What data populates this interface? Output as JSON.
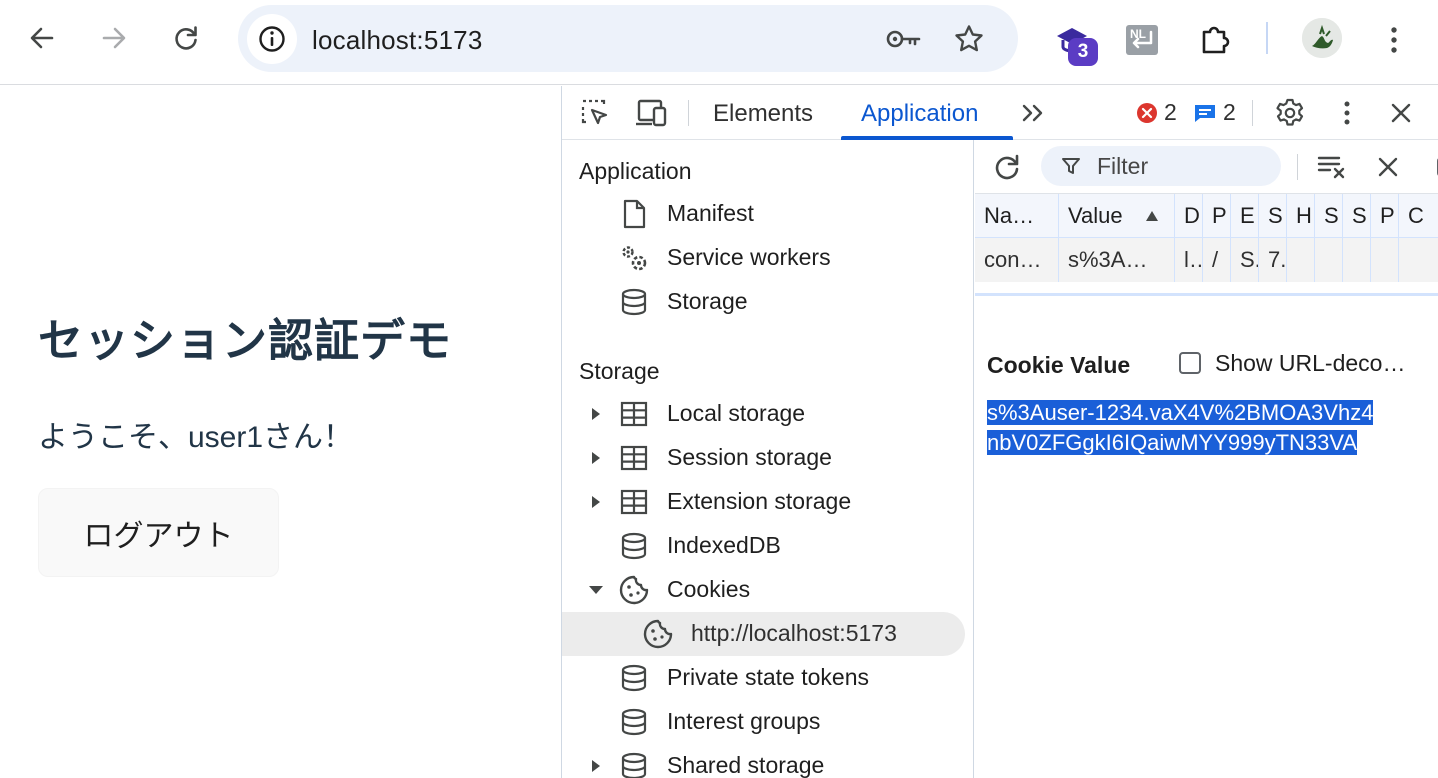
{
  "browser": {
    "url": "localhost:5173",
    "extension_badge": "3"
  },
  "page": {
    "title": "セッション認証デモ",
    "welcome": "ようこそ、user1さん！",
    "logout_label": "ログアウト"
  },
  "devtools": {
    "tabs": [
      {
        "label": "Elements",
        "active": false
      },
      {
        "label": "Application",
        "active": true
      }
    ],
    "error_count": "2",
    "message_count": "2",
    "sidebar": {
      "section_application": "Application",
      "application_items": [
        {
          "label": "Manifest",
          "icon": "document-icon"
        },
        {
          "label": "Service workers",
          "icon": "gears-icon"
        },
        {
          "label": "Storage",
          "icon": "database-icon"
        }
      ],
      "section_storage": "Storage",
      "storage_items": [
        {
          "label": "Local storage",
          "icon": "table-icon",
          "expandable": true
        },
        {
          "label": "Session storage",
          "icon": "table-icon",
          "expandable": true
        },
        {
          "label": "Extension storage",
          "icon": "table-icon",
          "expandable": true
        },
        {
          "label": "IndexedDB",
          "icon": "database-icon",
          "expandable": false
        },
        {
          "label": "Cookies",
          "icon": "cookie-icon",
          "expanded": true
        },
        {
          "label": "http://localhost:5173",
          "icon": "cookie-icon",
          "selected": true
        },
        {
          "label": "Private state tokens",
          "icon": "database-icon",
          "expandable": false
        },
        {
          "label": "Interest groups",
          "icon": "database-icon",
          "expandable": false
        },
        {
          "label": "Shared storage",
          "icon": "database-icon",
          "expandable": true
        }
      ]
    },
    "cookies": {
      "filter_placeholder": "Filter",
      "columns": [
        "Na…",
        "Value",
        "D",
        "P",
        "E",
        "S",
        "H",
        "S",
        "S",
        "P",
        "C"
      ],
      "row": [
        "con…",
        "s%3A…",
        "l…",
        "/",
        "S.",
        "7.",
        "",
        "",
        "",
        "",
        ""
      ],
      "detail_title": "Cookie Value",
      "show_decoded_label": "Show URL-deco…",
      "value_line1": "s%3Auser-1234.vaX4V%2BMOA3Vhz4",
      "value_line2": "nbV0ZFGgkI6IQaiwMYY999yTN33VA"
    }
  }
}
